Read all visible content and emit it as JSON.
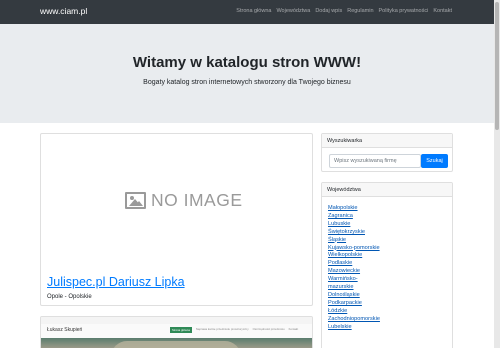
{
  "navbar": {
    "brand": "www.ciam.pl",
    "links": [
      "Strona główna",
      "Województwa",
      "Dodaj wpis",
      "Regulamin",
      "Polityka prywatności",
      "Kontakt"
    ]
  },
  "hero": {
    "title": "Witamy w katalogu stron WWW!",
    "subtitle": "Bogaty katalog stron internetowych stworzony dla Twojego biznesu"
  },
  "listings": [
    {
      "image_text": "NO IMAGE",
      "title": "Julispec.pl Dariusz Lipka",
      "location": "Opole - Opolskie"
    },
    {
      "thumbnail": {
        "name": "Łukasz Skupień",
        "nav": [
          "Strona główna",
          "Naprawa karnie przedmiotu prowizoryczny",
          "Oszczędności przedmiotu",
          "Kontakt"
        ]
      }
    }
  ],
  "sidebar": {
    "search": {
      "heading": "Wyszukiwarka",
      "placeholder": "Wpisz wyszukiwaną firmę",
      "button": "Szukaj"
    },
    "regions": {
      "heading": "Województwa",
      "items": [
        "Małopolskie",
        "Zagranica",
        "Lubuskie",
        "Świętokrzyskie",
        "Śląskie",
        "Kujawsko-pomorskie",
        "Wielkopolskie",
        "Podlaskie",
        "Mazowieckie",
        "Warmińsko-",
        "mazurskie",
        "Dolnośląskie",
        "Podkarpackie",
        "Łódzkie",
        "Zachodniopomorskie",
        "Lubelskie"
      ]
    }
  },
  "colors": {
    "navbar_bg": "#343a40",
    "jumbotron_bg": "#e9ecef",
    "link": "#007bff",
    "button": "#007bff"
  }
}
